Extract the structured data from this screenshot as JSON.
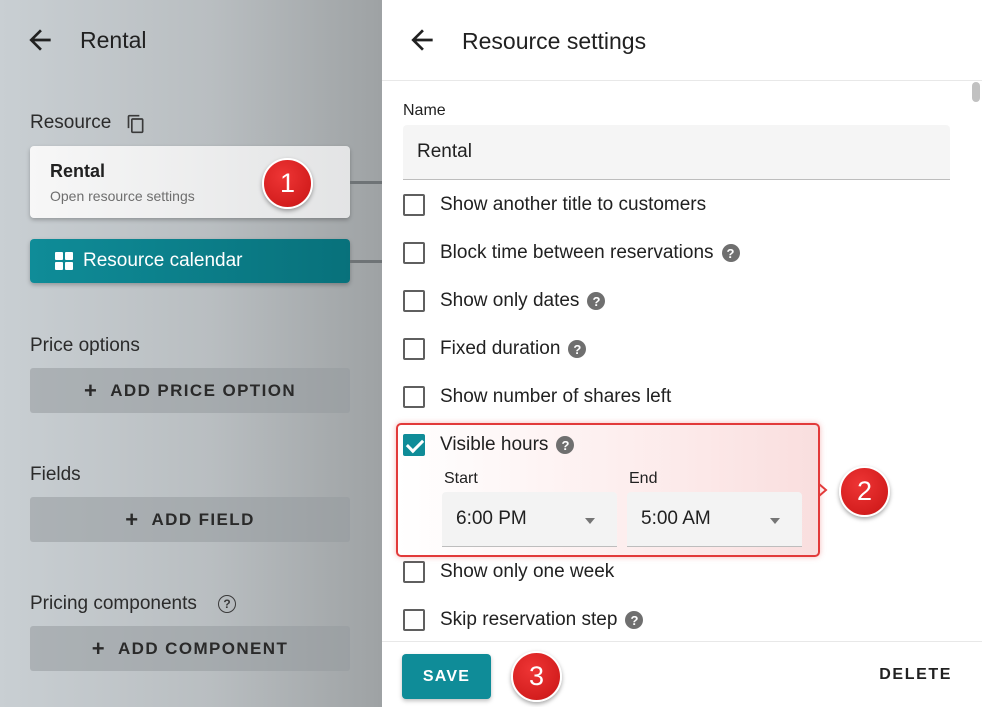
{
  "left_panel": {
    "title": "Rental",
    "resource_label": "Resource",
    "resource_card": {
      "title": "Rental",
      "subtitle": "Open resource settings"
    },
    "calendar_button": "Resource calendar",
    "price_options_label": "Price options",
    "add_price_option": "ADD PRICE OPTION",
    "fields_label": "Fields",
    "add_field": "ADD FIELD",
    "pricing_components_label": "Pricing components",
    "add_component": "ADD COMPONENT",
    "plus_glyph": "+",
    "help_glyph": "?"
  },
  "right_panel": {
    "title": "Resource settings",
    "name_label": "Name",
    "name_value": "Rental",
    "options": [
      {
        "label": "Show another title to customers",
        "checked": false,
        "help": false
      },
      {
        "label": "Block time between reservations",
        "checked": false,
        "help": true
      },
      {
        "label": "Show only dates",
        "checked": false,
        "help": true
      },
      {
        "label": "Fixed duration",
        "checked": false,
        "help": true
      },
      {
        "label": "Show number of shares left",
        "checked": false,
        "help": false
      },
      {
        "label": "Visible hours",
        "checked": true,
        "help": true
      },
      {
        "label": "Show only one week",
        "checked": false,
        "help": false
      },
      {
        "label": "Skip reservation step",
        "checked": false,
        "help": true
      }
    ],
    "visible_hours": {
      "start_label": "Start",
      "start_value": "6:00 PM",
      "end_label": "End",
      "end_value": "5:00 AM"
    },
    "save_button": "SAVE",
    "delete_button": "DELETE"
  },
  "annotations": {
    "badge1": "1",
    "badge2": "2",
    "badge3": "3"
  },
  "colors": {
    "accent": "#0f8c98",
    "annotation_red": "#d41e1e"
  },
  "icons": {
    "back": "arrow-left-icon",
    "copy": "copy-icon",
    "grid": "grid-icon",
    "help": "help-circle-icon",
    "caret": "caret-down-icon"
  }
}
